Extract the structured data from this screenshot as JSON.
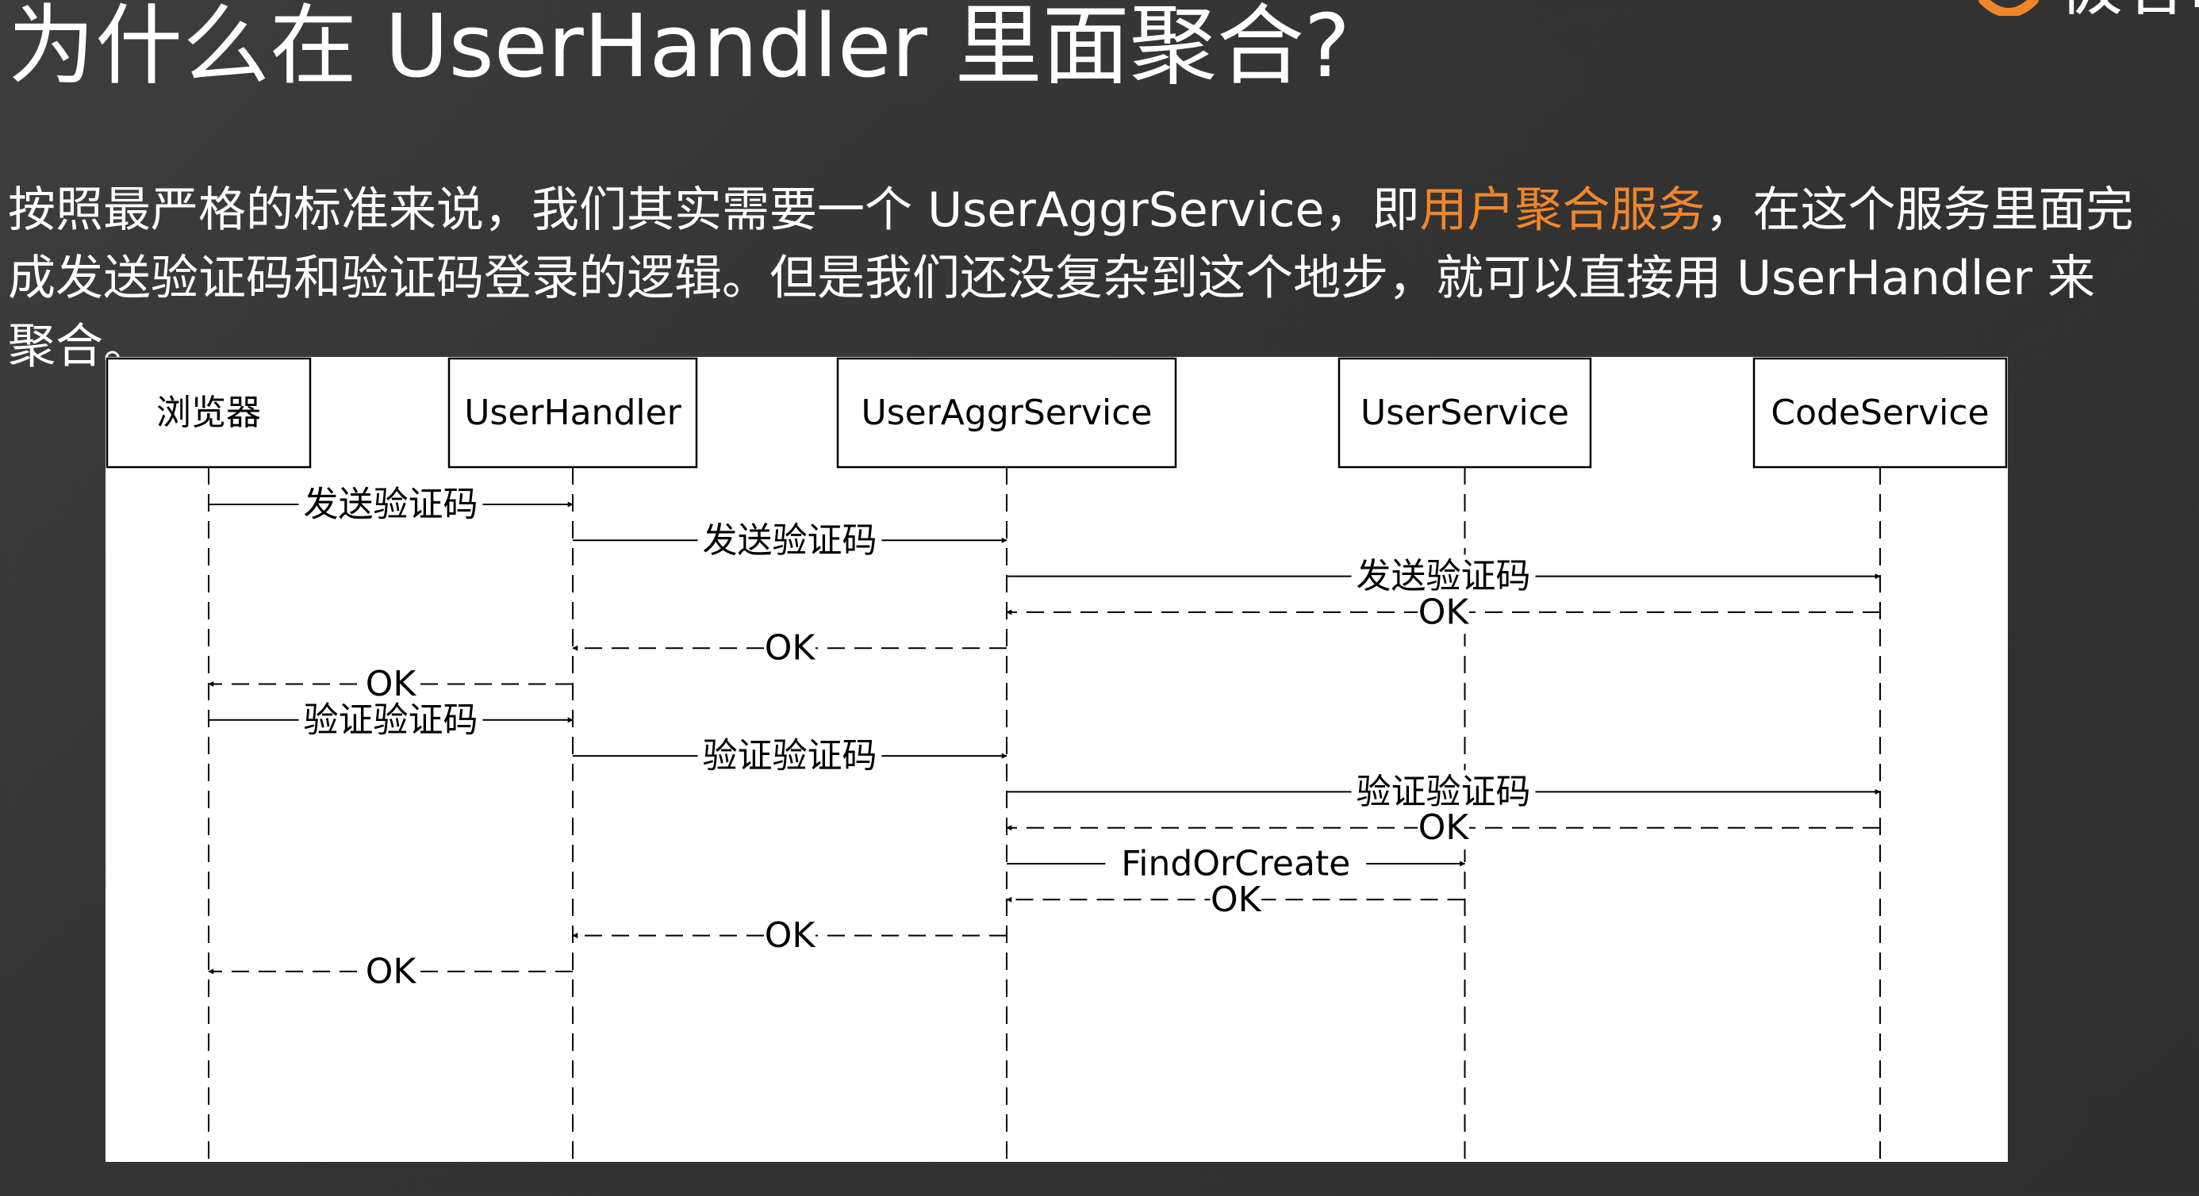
{
  "slide": {
    "title": "为什么在 UserHandler 里面聚合?",
    "brand": "极客时"
  },
  "intro": {
    "before": "按照最严格的标准来说，我们其实需要一个 UserAggrService，即",
    "highlight": "用户聚合服务",
    "after": "，在这个服务里面完成发送验证码和验证码登录的逻辑。但是我们还没复杂到这个地步，就可以直接用 UserHandler 来聚合。"
  },
  "colors": {
    "highlight": "#f0862a",
    "text": "#ffffff",
    "background": "#363636",
    "diagram_bg": "#ffffff",
    "diagram_ink": "#000000"
  },
  "diagram": {
    "participants": [
      {
        "id": "browser",
        "label": "浏览器"
      },
      {
        "id": "handler",
        "label": "UserHandler"
      },
      {
        "id": "aggr",
        "label": "UserAggrService"
      },
      {
        "id": "user",
        "label": "UserService"
      },
      {
        "id": "code",
        "label": "CodeService"
      }
    ],
    "messages": [
      {
        "from": "browser",
        "to": "handler",
        "label": "发送验证码",
        "style": "solid"
      },
      {
        "from": "handler",
        "to": "aggr",
        "label": "发送验证码",
        "style": "solid"
      },
      {
        "from": "aggr",
        "to": "code",
        "label": "发送验证码",
        "style": "solid"
      },
      {
        "from": "code",
        "to": "aggr",
        "label": "OK",
        "style": "dashed"
      },
      {
        "from": "aggr",
        "to": "handler",
        "label": "OK",
        "style": "dashed"
      },
      {
        "from": "handler",
        "to": "browser",
        "label": "OK",
        "style": "dashed"
      },
      {
        "from": "browser",
        "to": "handler",
        "label": "验证验证码",
        "style": "solid"
      },
      {
        "from": "handler",
        "to": "aggr",
        "label": "验证验证码",
        "style": "solid"
      },
      {
        "from": "aggr",
        "to": "code",
        "label": "验证验证码",
        "style": "solid"
      },
      {
        "from": "code",
        "to": "aggr",
        "label": "OK",
        "style": "dashed"
      },
      {
        "from": "aggr",
        "to": "user",
        "label": "FindOrCreate",
        "style": "solid"
      },
      {
        "from": "user",
        "to": "aggr",
        "label": "OK",
        "style": "dashed"
      },
      {
        "from": "aggr",
        "to": "handler",
        "label": "OK",
        "style": "dashed"
      },
      {
        "from": "handler",
        "to": "browser",
        "label": "OK",
        "style": "dashed"
      }
    ]
  }
}
